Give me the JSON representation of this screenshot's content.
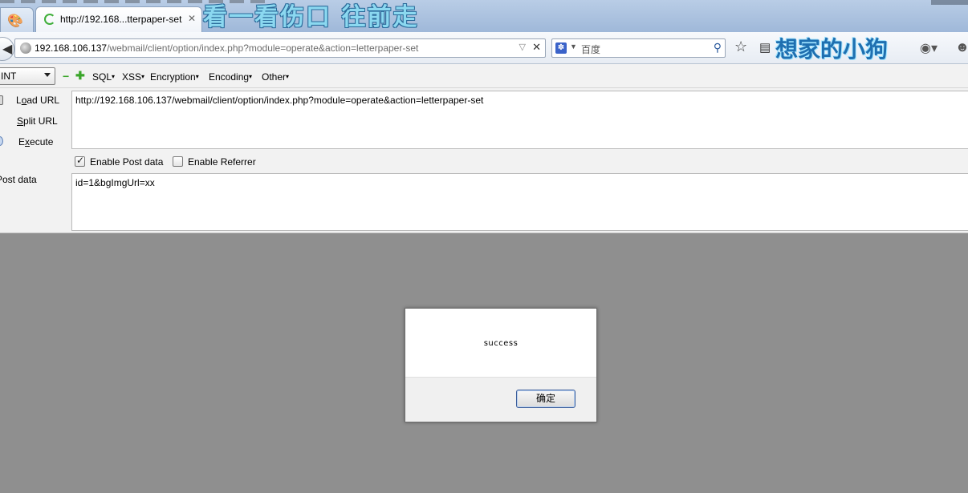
{
  "browser": {
    "tabs": [
      {
        "title": ""
      },
      {
        "title": "http://192.168...tterpaper-set"
      }
    ],
    "url_host": "192.168.106.137",
    "url_path": "/webmail/client/option/index.php?module=operate&action=letterpaper-set",
    "search_placeholder": "百度"
  },
  "overlays": {
    "top_text": "看一看伤口  往前走",
    "right_text": "想家的小狗"
  },
  "hackbar": {
    "select_value": "INT",
    "menus": [
      "SQL",
      "XSS",
      "Encryption",
      "Encoding",
      "Other"
    ],
    "actions": {
      "load_pre": "L",
      "load_u": "o",
      "load_post": "ad URL",
      "split_u": "S",
      "split_post": "plit URL",
      "exec_pre": "E",
      "exec_u": "x",
      "exec_post": "ecute"
    },
    "url_value": "http://192.168.106.137/webmail/client/option/index.php?module=operate&action=letterpaper-set",
    "enable_post_label": "Enable Post data",
    "enable_post_checked": true,
    "enable_referrer_label": "Enable Referrer",
    "enable_referrer_checked": false,
    "post_label": "Post data",
    "post_value": "id=1&bgImgUrl=xx"
  },
  "dialog": {
    "message": "success",
    "ok_label": "确定"
  }
}
